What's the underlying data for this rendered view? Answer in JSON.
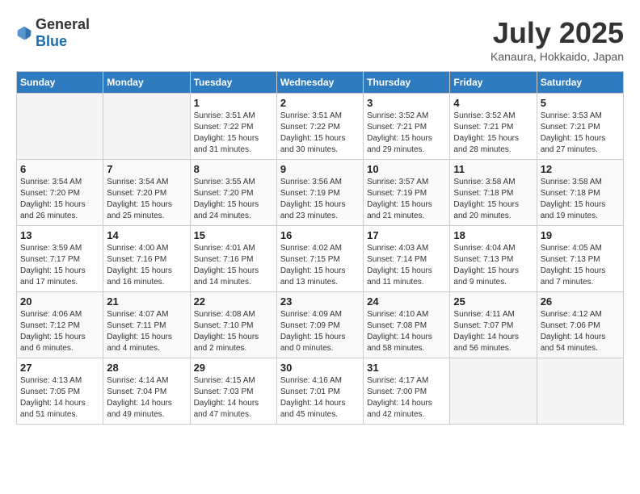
{
  "logo": {
    "general": "General",
    "blue": "Blue"
  },
  "header": {
    "title": "July 2025",
    "subtitle": "Kanaura, Hokkaido, Japan"
  },
  "weekdays": [
    "Sunday",
    "Monday",
    "Tuesday",
    "Wednesday",
    "Thursday",
    "Friday",
    "Saturday"
  ],
  "weeks": [
    [
      {
        "day": "",
        "sunrise": "",
        "sunset": "",
        "daylight": ""
      },
      {
        "day": "",
        "sunrise": "",
        "sunset": "",
        "daylight": ""
      },
      {
        "day": "1",
        "sunrise": "Sunrise: 3:51 AM",
        "sunset": "Sunset: 7:22 PM",
        "daylight": "Daylight: 15 hours and 31 minutes."
      },
      {
        "day": "2",
        "sunrise": "Sunrise: 3:51 AM",
        "sunset": "Sunset: 7:22 PM",
        "daylight": "Daylight: 15 hours and 30 minutes."
      },
      {
        "day": "3",
        "sunrise": "Sunrise: 3:52 AM",
        "sunset": "Sunset: 7:21 PM",
        "daylight": "Daylight: 15 hours and 29 minutes."
      },
      {
        "day": "4",
        "sunrise": "Sunrise: 3:52 AM",
        "sunset": "Sunset: 7:21 PM",
        "daylight": "Daylight: 15 hours and 28 minutes."
      },
      {
        "day": "5",
        "sunrise": "Sunrise: 3:53 AM",
        "sunset": "Sunset: 7:21 PM",
        "daylight": "Daylight: 15 hours and 27 minutes."
      }
    ],
    [
      {
        "day": "6",
        "sunrise": "Sunrise: 3:54 AM",
        "sunset": "Sunset: 7:20 PM",
        "daylight": "Daylight: 15 hours and 26 minutes."
      },
      {
        "day": "7",
        "sunrise": "Sunrise: 3:54 AM",
        "sunset": "Sunset: 7:20 PM",
        "daylight": "Daylight: 15 hours and 25 minutes."
      },
      {
        "day": "8",
        "sunrise": "Sunrise: 3:55 AM",
        "sunset": "Sunset: 7:20 PM",
        "daylight": "Daylight: 15 hours and 24 minutes."
      },
      {
        "day": "9",
        "sunrise": "Sunrise: 3:56 AM",
        "sunset": "Sunset: 7:19 PM",
        "daylight": "Daylight: 15 hours and 23 minutes."
      },
      {
        "day": "10",
        "sunrise": "Sunrise: 3:57 AM",
        "sunset": "Sunset: 7:19 PM",
        "daylight": "Daylight: 15 hours and 21 minutes."
      },
      {
        "day": "11",
        "sunrise": "Sunrise: 3:58 AM",
        "sunset": "Sunset: 7:18 PM",
        "daylight": "Daylight: 15 hours and 20 minutes."
      },
      {
        "day": "12",
        "sunrise": "Sunrise: 3:58 AM",
        "sunset": "Sunset: 7:18 PM",
        "daylight": "Daylight: 15 hours and 19 minutes."
      }
    ],
    [
      {
        "day": "13",
        "sunrise": "Sunrise: 3:59 AM",
        "sunset": "Sunset: 7:17 PM",
        "daylight": "Daylight: 15 hours and 17 minutes."
      },
      {
        "day": "14",
        "sunrise": "Sunrise: 4:00 AM",
        "sunset": "Sunset: 7:16 PM",
        "daylight": "Daylight: 15 hours and 16 minutes."
      },
      {
        "day": "15",
        "sunrise": "Sunrise: 4:01 AM",
        "sunset": "Sunset: 7:16 PM",
        "daylight": "Daylight: 15 hours and 14 minutes."
      },
      {
        "day": "16",
        "sunrise": "Sunrise: 4:02 AM",
        "sunset": "Sunset: 7:15 PM",
        "daylight": "Daylight: 15 hours and 13 minutes."
      },
      {
        "day": "17",
        "sunrise": "Sunrise: 4:03 AM",
        "sunset": "Sunset: 7:14 PM",
        "daylight": "Daylight: 15 hours and 11 minutes."
      },
      {
        "day": "18",
        "sunrise": "Sunrise: 4:04 AM",
        "sunset": "Sunset: 7:13 PM",
        "daylight": "Daylight: 15 hours and 9 minutes."
      },
      {
        "day": "19",
        "sunrise": "Sunrise: 4:05 AM",
        "sunset": "Sunset: 7:13 PM",
        "daylight": "Daylight: 15 hours and 7 minutes."
      }
    ],
    [
      {
        "day": "20",
        "sunrise": "Sunrise: 4:06 AM",
        "sunset": "Sunset: 7:12 PM",
        "daylight": "Daylight: 15 hours and 6 minutes."
      },
      {
        "day": "21",
        "sunrise": "Sunrise: 4:07 AM",
        "sunset": "Sunset: 7:11 PM",
        "daylight": "Daylight: 15 hours and 4 minutes."
      },
      {
        "day": "22",
        "sunrise": "Sunrise: 4:08 AM",
        "sunset": "Sunset: 7:10 PM",
        "daylight": "Daylight: 15 hours and 2 minutes."
      },
      {
        "day": "23",
        "sunrise": "Sunrise: 4:09 AM",
        "sunset": "Sunset: 7:09 PM",
        "daylight": "Daylight: 15 hours and 0 minutes."
      },
      {
        "day": "24",
        "sunrise": "Sunrise: 4:10 AM",
        "sunset": "Sunset: 7:08 PM",
        "daylight": "Daylight: 14 hours and 58 minutes."
      },
      {
        "day": "25",
        "sunrise": "Sunrise: 4:11 AM",
        "sunset": "Sunset: 7:07 PM",
        "daylight": "Daylight: 14 hours and 56 minutes."
      },
      {
        "day": "26",
        "sunrise": "Sunrise: 4:12 AM",
        "sunset": "Sunset: 7:06 PM",
        "daylight": "Daylight: 14 hours and 54 minutes."
      }
    ],
    [
      {
        "day": "27",
        "sunrise": "Sunrise: 4:13 AM",
        "sunset": "Sunset: 7:05 PM",
        "daylight": "Daylight: 14 hours and 51 minutes."
      },
      {
        "day": "28",
        "sunrise": "Sunrise: 4:14 AM",
        "sunset": "Sunset: 7:04 PM",
        "daylight": "Daylight: 14 hours and 49 minutes."
      },
      {
        "day": "29",
        "sunrise": "Sunrise: 4:15 AM",
        "sunset": "Sunset: 7:03 PM",
        "daylight": "Daylight: 14 hours and 47 minutes."
      },
      {
        "day": "30",
        "sunrise": "Sunrise: 4:16 AM",
        "sunset": "Sunset: 7:01 PM",
        "daylight": "Daylight: 14 hours and 45 minutes."
      },
      {
        "day": "31",
        "sunrise": "Sunrise: 4:17 AM",
        "sunset": "Sunset: 7:00 PM",
        "daylight": "Daylight: 14 hours and 42 minutes."
      },
      {
        "day": "",
        "sunrise": "",
        "sunset": "",
        "daylight": ""
      },
      {
        "day": "",
        "sunrise": "",
        "sunset": "",
        "daylight": ""
      }
    ]
  ]
}
